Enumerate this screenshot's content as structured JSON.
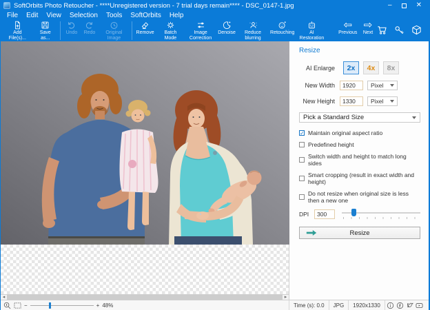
{
  "ui": {
    "check_glyph": "✓",
    "scroll_left": "◂",
    "scroll_right": "▸"
  },
  "colors": {
    "chrome_blue": "#0b7bd8",
    "selected_option_border": "#3c8fd8",
    "selected_option_text": "#1272c4",
    "option_4x_text": "#dd8b14",
    "resize_arrow": "#2f9e96",
    "slider_handle": "#1b7fd0"
  },
  "window": {
    "title": "SoftOrbits Photo Retoucher - ****Unregistered version - 7 trial days remain**** - DSC_0147-1.jpg",
    "controls": {
      "minimize": "–",
      "close": "✕"
    }
  },
  "menu": {
    "items": [
      "File",
      "Edit",
      "View",
      "Selection",
      "Tools",
      "SoftOrbits",
      "Help"
    ]
  },
  "toolbar": {
    "items": [
      {
        "label": "Add File(s)...",
        "icon": "add-file"
      },
      {
        "label": "Save as...",
        "icon": "save"
      },
      {
        "label": "Undo",
        "icon": "undo",
        "disabled": true
      },
      {
        "label": "Redo",
        "icon": "redo",
        "disabled": true
      },
      {
        "label": "Original Image",
        "icon": "history-clock",
        "disabled": true
      },
      {
        "label": "Remove",
        "icon": "eraser"
      },
      {
        "label": "Batch Mode",
        "icon": "gear"
      },
      {
        "label": "Image Correction",
        "icon": "sliders"
      },
      {
        "label": "Denoise",
        "icon": "crescent"
      },
      {
        "label": "Reduce blurring",
        "icon": "person-dots"
      },
      {
        "label": "Retouching",
        "icon": "face-sparkle"
      },
      {
        "label": "AI Restoration",
        "icon": "robot"
      },
      {
        "label": "Previous",
        "icon": "arrow-left",
        "glyph": "⇦"
      },
      {
        "label": "Next",
        "icon": "arrow-right",
        "glyph": "⇨"
      }
    ],
    "right_icons": [
      "cart",
      "key",
      "package"
    ]
  },
  "panel": {
    "title": "Resize",
    "ai_enlarge": {
      "label": "AI Enlarge",
      "options": [
        {
          "label": "2x",
          "state": "selected"
        },
        {
          "label": "4x",
          "state": "normal"
        },
        {
          "label": "8x",
          "state": "disabled"
        }
      ]
    },
    "new_width": {
      "label": "New Width",
      "value": "1920",
      "unit": "Pixel"
    },
    "new_height": {
      "label": "New Height",
      "value": "1330",
      "unit": "Pixel"
    },
    "standard_size": {
      "placeholder": "Pick a Standard Size"
    },
    "checkboxes": [
      {
        "label": "Maintain original aspect ratio",
        "checked": true
      },
      {
        "label": "Predefined height",
        "checked": false
      },
      {
        "label": "Switch width and height to match long sides",
        "checked": false
      },
      {
        "label": "Smart cropping (result in exact width and height)",
        "checked": false
      },
      {
        "label": "Do not resize when original size is less then a new one",
        "checked": false
      }
    ],
    "dpi": {
      "label": "DPI",
      "value": "300"
    },
    "resize_button": "Resize"
  },
  "statusbar": {
    "zoom_out": "−",
    "zoom_in": "+",
    "zoom_percent": "48%",
    "time": "Time (s): 0.0",
    "format": "JPG",
    "dimensions": "1920x1330"
  }
}
